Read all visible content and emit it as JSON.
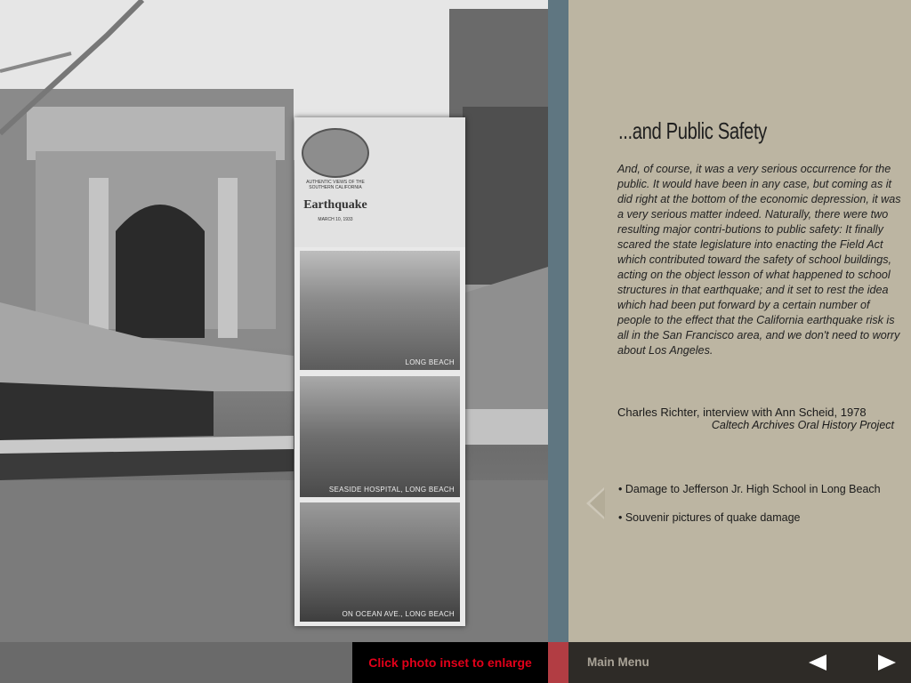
{
  "background_photo": {
    "description_icon": "earthquake-damage-photo"
  },
  "inset": {
    "cover": {
      "line1": "AUTHENTIC VIEWS OF THE SOUTHERN CALIFORNIA",
      "title": "Earthquake",
      "date": "MARCH 10, 1933"
    },
    "panels": [
      {
        "caption": "LONG BEACH"
      },
      {
        "caption": "SEASIDE HOSPITAL, LONG BEACH"
      },
      {
        "caption": "ON OCEAN AVE., LONG BEACH"
      }
    ]
  },
  "sidebar": {
    "title": "...and Public Safety",
    "quote": "And, of course, it was a very serious occurrence for the public. It would have been in any case, but coming as it did right at the bottom of the economic depression, it was a very serious matter indeed. Naturally, there were two resulting major contri-butions to public safety: It finally scared the state legislature into enacting the Field Act which contributed toward the safety of school buildings, acting on the object lesson of what happened to school structures in that earthquake; and it set to rest the idea which had been put forward by a certain number of people to the effect that the California earthquake risk is all in the San Francisco area, and we don't need to worry about Los Angeles.",
    "attribution": "Charles Richter, interview with Ann Scheid, 1978",
    "source": "Caltech Archives Oral History Project",
    "links": [
      "• Damage to Jefferson Jr. High School in Long Beach",
      "• Souvenir pictures of quake damage"
    ]
  },
  "footer": {
    "hint": "Click photo inset to enlarge",
    "main_menu": "Main Menu"
  },
  "colors": {
    "sidebar_bg": "#bcb5a2",
    "teal_bar": "#5f7681",
    "hint_red": "#e2001a",
    "footer_nav_bg": "#2e2b27"
  }
}
